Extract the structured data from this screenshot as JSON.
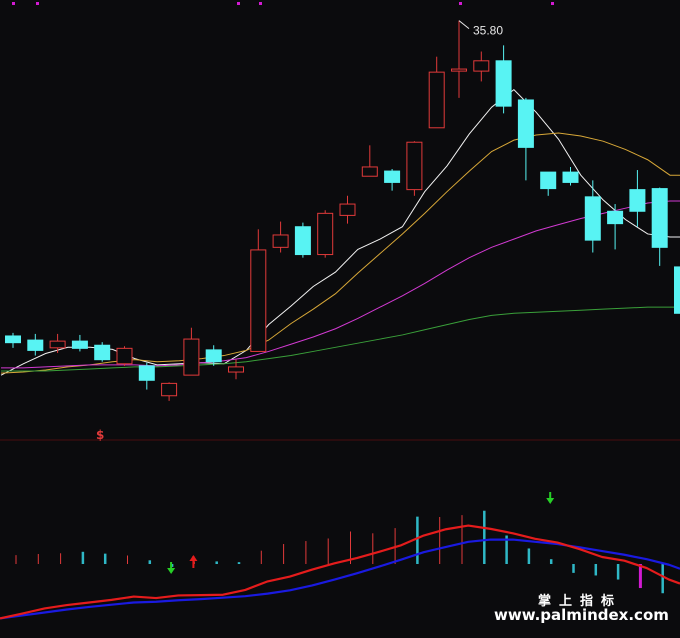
{
  "chart_data": [
    {
      "type": "candlestick",
      "title": "",
      "annotation_peak": "35.80",
      "signal_marker": "$",
      "candles": [
        {
          "o": 29.55,
          "c": 29.68,
          "h": 29.74,
          "l": 29.45,
          "dir": "down"
        },
        {
          "o": 29.6,
          "c": 29.4,
          "h": 29.72,
          "l": 29.3,
          "dir": "down"
        },
        {
          "o": 29.45,
          "c": 29.58,
          "h": 29.72,
          "l": 29.35,
          "dir": "up"
        },
        {
          "o": 29.58,
          "c": 29.44,
          "h": 29.7,
          "l": 29.38,
          "dir": "down"
        },
        {
          "o": 29.5,
          "c": 29.22,
          "h": 29.56,
          "l": 29.18,
          "dir": "down"
        },
        {
          "o": 29.14,
          "c": 29.44,
          "h": 29.48,
          "l": 29.1,
          "dir": "up"
        },
        {
          "o": 29.1,
          "c": 28.82,
          "h": 29.16,
          "l": 28.64,
          "dir": "down"
        },
        {
          "o": 28.52,
          "c": 28.76,
          "h": 28.78,
          "l": 28.42,
          "dir": "up"
        },
        {
          "o": 28.92,
          "c": 29.62,
          "h": 29.84,
          "l": 28.92,
          "dir": "up"
        },
        {
          "o": 29.41,
          "c": 29.18,
          "h": 29.5,
          "l": 29.1,
          "dir": "down"
        },
        {
          "o": 28.98,
          "c": 29.08,
          "h": 29.22,
          "l": 28.84,
          "dir": "up"
        },
        {
          "o": 29.38,
          "c": 31.35,
          "h": 31.75,
          "l": 29.38,
          "dir": "up"
        },
        {
          "o": 31.4,
          "c": 31.64,
          "h": 31.9,
          "l": 31.3,
          "dir": "up"
        },
        {
          "o": 31.8,
          "c": 31.26,
          "h": 31.88,
          "l": 31.2,
          "dir": "down"
        },
        {
          "o": 31.26,
          "c": 32.06,
          "h": 32.12,
          "l": 31.2,
          "dir": "up"
        },
        {
          "o": 32.02,
          "c": 32.24,
          "h": 32.4,
          "l": 31.86,
          "dir": "up"
        },
        {
          "o": 32.78,
          "c": 32.96,
          "h": 33.38,
          "l": 32.78,
          "dir": "up"
        },
        {
          "o": 32.88,
          "c": 32.66,
          "h": 32.92,
          "l": 32.5,
          "dir": "down"
        },
        {
          "o": 32.52,
          "c": 33.44,
          "h": 33.46,
          "l": 32.4,
          "dir": "up"
        },
        {
          "o": 33.72,
          "c": 34.8,
          "h": 35.1,
          "l": 33.72,
          "dir": "up"
        },
        {
          "o": 34.82,
          "c": 34.86,
          "h": 35.8,
          "l": 34.3,
          "dir": "up"
        },
        {
          "o": 34.82,
          "c": 35.02,
          "h": 35.2,
          "l": 34.62,
          "dir": "up"
        },
        {
          "o": 35.02,
          "c": 34.14,
          "h": 35.32,
          "l": 34.0,
          "dir": "down"
        },
        {
          "o": 34.26,
          "c": 33.34,
          "h": 34.3,
          "l": 32.7,
          "dir": "down"
        },
        {
          "o": 32.86,
          "c": 32.54,
          "h": 32.86,
          "l": 32.4,
          "dir": "down"
        },
        {
          "o": 32.86,
          "c": 32.66,
          "h": 32.96,
          "l": 32.6,
          "dir": "down"
        },
        {
          "o": 32.38,
          "c": 31.54,
          "h": 32.7,
          "l": 31.3,
          "dir": "down"
        },
        {
          "o": 32.1,
          "c": 31.86,
          "h": 32.24,
          "l": 31.36,
          "dir": "down"
        },
        {
          "o": 32.52,
          "c": 32.1,
          "h": 32.9,
          "l": 31.8,
          "dir": "down"
        },
        {
          "o": 32.54,
          "c": 31.4,
          "h": 32.56,
          "l": 31.04,
          "dir": "down"
        },
        {
          "o": 31.02,
          "c": 30.12,
          "h": 31.12,
          "l": 30.1,
          "dir": "down"
        }
      ],
      "moving_averages": [
        {
          "name": "MA-short",
          "color": "#f2f2f2",
          "values": [
            28.92,
            29.14,
            29.34,
            29.46,
            29.46,
            29.42,
            29.24,
            29.12,
            29.14,
            29.16,
            29.14,
            29.4,
            29.9,
            30.26,
            30.64,
            30.92,
            31.36,
            31.56,
            31.8,
            32.48,
            32.98,
            33.6,
            34.12,
            34.46,
            34.02,
            33.5,
            32.8,
            32.32,
            31.94,
            31.66,
            31.6
          ]
        },
        {
          "name": "MA-mid",
          "color": "#d8a838",
          "values": [
            28.96,
            28.98,
            29.02,
            29.08,
            29.12,
            29.18,
            29.22,
            29.18,
            29.2,
            29.24,
            29.3,
            29.4,
            29.6,
            29.92,
            30.2,
            30.5,
            30.9,
            31.28,
            31.66,
            32.06,
            32.48,
            32.88,
            33.26,
            33.48,
            33.58,
            33.62,
            33.56,
            33.46,
            33.3,
            33.1,
            32.8
          ]
        },
        {
          "name": "MA-long",
          "color": "#d23ad2",
          "values": [
            29.06,
            29.06,
            29.08,
            29.1,
            29.12,
            29.12,
            29.12,
            29.1,
            29.12,
            29.16,
            29.2,
            29.26,
            29.38,
            29.52,
            29.66,
            29.82,
            30.02,
            30.24,
            30.46,
            30.7,
            30.96,
            31.2,
            31.4,
            31.56,
            31.72,
            31.84,
            31.96,
            32.06,
            32.16,
            32.26,
            32.3
          ]
        },
        {
          "name": "MA-longest",
          "color": "#3aa03a",
          "values": [
            29.0,
            29.0,
            29.0,
            29.02,
            29.04,
            29.06,
            29.08,
            29.08,
            29.1,
            29.12,
            29.14,
            29.18,
            29.24,
            29.3,
            29.38,
            29.46,
            29.54,
            29.62,
            29.7,
            29.8,
            29.9,
            30.0,
            30.08,
            30.12,
            30.14,
            30.16,
            30.18,
            30.2,
            30.22,
            30.24,
            30.24
          ]
        }
      ],
      "ylim": [
        27.7,
        36.2
      ]
    },
    {
      "type": "indicator",
      "title": "",
      "ylim": [
        -3.2,
        3.8
      ],
      "fast_line": {
        "color": "#e51c1c",
        "values": [
          -2.4,
          -2.14,
          -1.86,
          -1.68,
          -1.54,
          -1.4,
          -1.22,
          -1.3,
          -1.16,
          -1.14,
          -1.12,
          -0.86,
          -0.4,
          -0.14,
          0.24,
          0.58,
          0.86,
          1.2,
          1.56,
          2.08,
          2.42,
          2.62,
          2.44,
          2.2,
          1.9,
          1.7,
          1.34,
          0.92,
          0.72,
          0.32,
          -0.3
        ]
      },
      "slow_line": {
        "color": "#1a1ae0",
        "values": [
          -2.4,
          -2.24,
          -2.08,
          -1.92,
          -1.78,
          -1.66,
          -1.54,
          -1.5,
          -1.42,
          -1.36,
          -1.28,
          -1.2,
          -1.06,
          -0.88,
          -0.62,
          -0.3,
          0.04,
          0.4,
          0.78,
          1.18,
          1.46,
          1.74,
          1.86,
          1.86,
          1.74,
          1.62,
          1.44,
          1.24,
          1.04,
          0.8,
          0.5
        ]
      },
      "histogram": [
        {
          "v": 0.48,
          "color": "#e23a3a"
        },
        {
          "v": 0.54,
          "color": "#e23a3a"
        },
        {
          "v": 0.58,
          "color": "#e23a3a"
        },
        {
          "v": 0.66,
          "color": "#2fb8c6"
        },
        {
          "v": 0.56,
          "color": "#2fb8c6"
        },
        {
          "v": 0.46,
          "color": "#e23a3a"
        },
        {
          "v": 0.2,
          "color": "#2fb8c6"
        },
        {
          "v": -0.16,
          "color": "#2fb8c6"
        },
        {
          "v": 0.14,
          "color": "#e23a3a"
        },
        {
          "v": 0.14,
          "color": "#2fb8c6"
        },
        {
          "v": 0.1,
          "color": "#2fb8c6"
        },
        {
          "v": 0.72,
          "color": "#e23a3a"
        },
        {
          "v": 1.08,
          "color": "#e23a3a"
        },
        {
          "v": 1.24,
          "color": "#e23a3a"
        },
        {
          "v": 1.38,
          "color": "#e23a3a"
        },
        {
          "v": 1.76,
          "color": "#e23a3a"
        },
        {
          "v": 1.66,
          "color": "#e23a3a"
        },
        {
          "v": 1.94,
          "color": "#e23a3a"
        },
        {
          "v": 2.56,
          "color": "#2fb8c6"
        },
        {
          "v": 2.54,
          "color": "#e23a3a"
        },
        {
          "v": 2.64,
          "color": "#e23a3a"
        },
        {
          "v": 2.88,
          "color": "#2fb8c6"
        },
        {
          "v": 1.54,
          "color": "#2fb8c6"
        },
        {
          "v": 0.84,
          "color": "#2fb8c6"
        },
        {
          "v": 0.26,
          "color": "#2fb8c6"
        },
        {
          "v": -0.48,
          "color": "#2fb8c6"
        },
        {
          "v": -0.62,
          "color": "#2fb8c6"
        },
        {
          "v": -0.84,
          "color": "#2fb8c6"
        },
        {
          "v": -1.3,
          "color": "#d21ad2"
        },
        {
          "v": -1.58,
          "color": "#2fb8c6"
        },
        {
          "v": -1.8,
          "color": "#2fb8c6"
        }
      ],
      "signals": [
        {
          "index": 7,
          "kind": "sell",
          "color": "#26d026"
        },
        {
          "index": 8,
          "kind": "buy",
          "color": "#e51c1c"
        },
        {
          "index": 24,
          "kind": "sell",
          "color": "#26d026"
        }
      ]
    }
  ],
  "colors": {
    "background": "#0b0b0d",
    "up_candle": "#e23a3a",
    "down_candle": "#58f3f3",
    "panel_divider": "#4a0e0e",
    "top_marker": "#d21ad2"
  },
  "watermark": {
    "cn": "掌上指标",
    "en": "www.palmindex.com"
  }
}
